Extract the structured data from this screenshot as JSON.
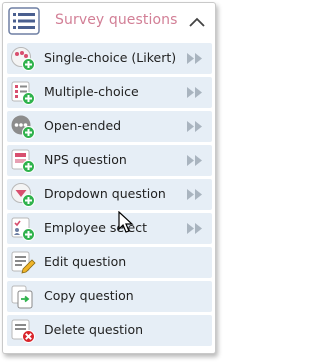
{
  "menu": {
    "title": "Survey questions",
    "header_icon": "list-menu-icon",
    "collapse_icon": "chevron-up-icon",
    "colors": {
      "title": "#d27f96",
      "item_bg": "#e6eef6",
      "add_badge": "#2fb24c",
      "delete_badge": "#d9262c",
      "arrow": "#a9b4bf"
    },
    "items": [
      {
        "label": "Single-choice (Likert)",
        "icon": "single-choice-add-icon",
        "has_submenu": true
      },
      {
        "label": "Multiple-choice",
        "icon": "multiple-choice-add-icon",
        "has_submenu": true
      },
      {
        "label": "Open-ended",
        "icon": "open-ended-add-icon",
        "has_submenu": true
      },
      {
        "label": "NPS question",
        "icon": "nps-add-icon",
        "has_submenu": true
      },
      {
        "label": "Dropdown question",
        "icon": "dropdown-add-icon",
        "has_submenu": true
      },
      {
        "label": "Employee select",
        "icon": "employee-select-add-icon",
        "has_submenu": true
      },
      {
        "label": "Edit question",
        "icon": "edit-question-icon",
        "has_submenu": false
      },
      {
        "label": "Copy question",
        "icon": "copy-question-icon",
        "has_submenu": false
      },
      {
        "label": "Delete question",
        "icon": "delete-question-icon",
        "has_submenu": false
      }
    ]
  }
}
